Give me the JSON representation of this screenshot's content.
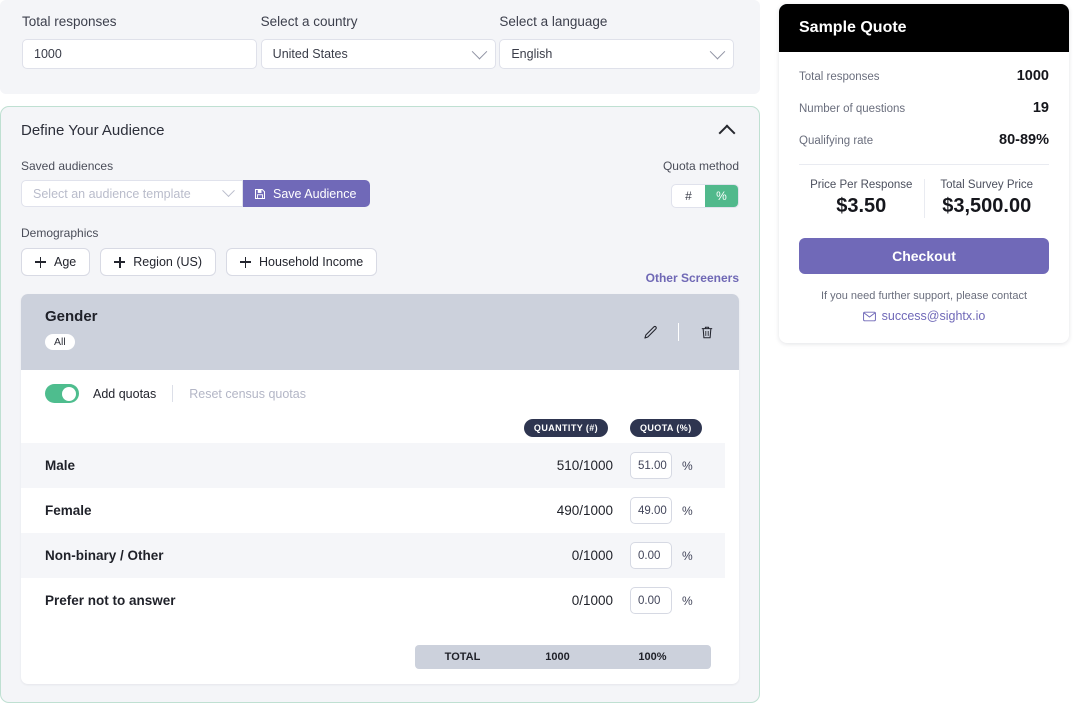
{
  "top_bar": {
    "fields": [
      {
        "label": "Total responses",
        "value": "1000",
        "type": "input"
      },
      {
        "label": "Select a country",
        "value": "United States",
        "type": "select"
      },
      {
        "label": "Select a language",
        "value": "English",
        "type": "select"
      }
    ]
  },
  "audience": {
    "title": "Define Your Audience",
    "collapse_icon": "chevron-up-icon",
    "saved_audiences_label": "Saved audiences",
    "template_placeholder": "Select an audience template",
    "save_button": "Save Audience",
    "save_icon": "save-disk-icon",
    "quota_method_label": "Quota method",
    "quota_method_options": [
      "#",
      "%"
    ],
    "quota_method_selected": "%",
    "demographics_label": "Demographics",
    "demographic_chips": [
      "Age",
      "Region (US)",
      "Household Income"
    ],
    "other_screeners": "Other Screeners"
  },
  "quota_panel": {
    "title": "Gender",
    "pill": "All",
    "edit_icon": "pencil-icon",
    "delete_icon": "trash-icon",
    "toggle_label": "Add quotas",
    "toggle_on": true,
    "reset_link": "Reset census quotas",
    "columns": {
      "quantity": "QUANTITY (#)",
      "quota": "QUOTA (%)"
    },
    "percent_sign": "%",
    "rows": [
      {
        "name": "Male",
        "quantity": "510/1000",
        "quota": "51.00"
      },
      {
        "name": "Female",
        "quantity": "490/1000",
        "quota": "49.00"
      },
      {
        "name": "Non-binary / Other",
        "quantity": "0/1000",
        "quota": "0.00"
      },
      {
        "name": "Prefer not to answer",
        "quantity": "0/1000",
        "quota": "0.00"
      }
    ],
    "total": {
      "label": "TOTAL",
      "quantity": "1000",
      "quota": "100%"
    }
  },
  "quote": {
    "title": "Sample Quote",
    "lines": [
      {
        "label": "Total responses",
        "value": "1000"
      },
      {
        "label": "Number of questions",
        "value": "19"
      },
      {
        "label": "Qualifying rate",
        "value": "80-89%"
      }
    ],
    "price_per_response_label": "Price Per Response",
    "price_per_response": "$3.50",
    "total_price_label": "Total Survey Price",
    "total_price": "$3,500.00",
    "checkout": "Checkout",
    "support_text": "If you need further support, please contact",
    "support_email": "success@sightx.io",
    "mail_icon": "envelope-icon"
  },
  "colors": {
    "accent_purple": "#7069b8",
    "accent_green": "#51b98c",
    "badge_navy": "#2e3550",
    "panel_header_gray": "#ccd1dc",
    "card_border_mint": "#bfe0d2"
  }
}
